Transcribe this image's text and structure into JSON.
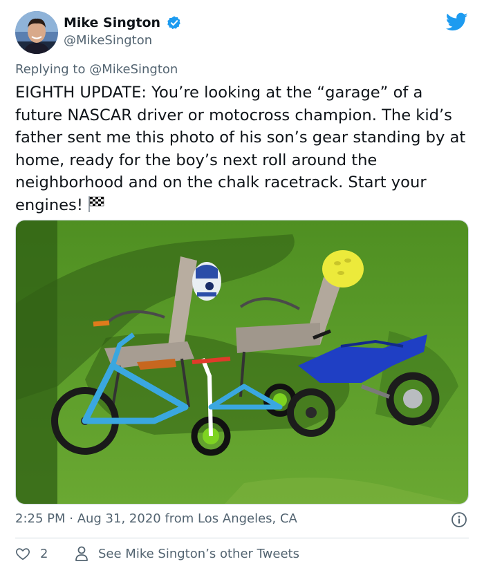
{
  "author": {
    "display_name": "Mike Sington",
    "handle": "@MikeSington",
    "verified_icon": "verified-badge-icon",
    "avatar_icon": "avatar"
  },
  "brand": {
    "icon": "twitter-bird-icon",
    "color": "#1d9bf0"
  },
  "reply_context": "Replying to @MikeSington",
  "tweet_text": "EIGHTH UPDATE: You’re looking at the “garage” of a future NASCAR driver or motocross champion. The kid’s father sent me this photo of his son’s gear standing by at home, ready for the boy’s next roll around the neighborhood and on the chalk racetrack. Start your engines!",
  "emoji_icon": "checkered-flag-icon",
  "timestamp": "2:25 PM · Aug 31, 2020 from Los Angeles, CA",
  "actions": {
    "like_count": "2",
    "profile_link_label": "See Mike Sington’s other Tweets"
  },
  "colors": {
    "text_primary": "#0f1419",
    "text_secondary": "#536471",
    "like_icon": "#536471",
    "grass": "#3f7d1c"
  }
}
